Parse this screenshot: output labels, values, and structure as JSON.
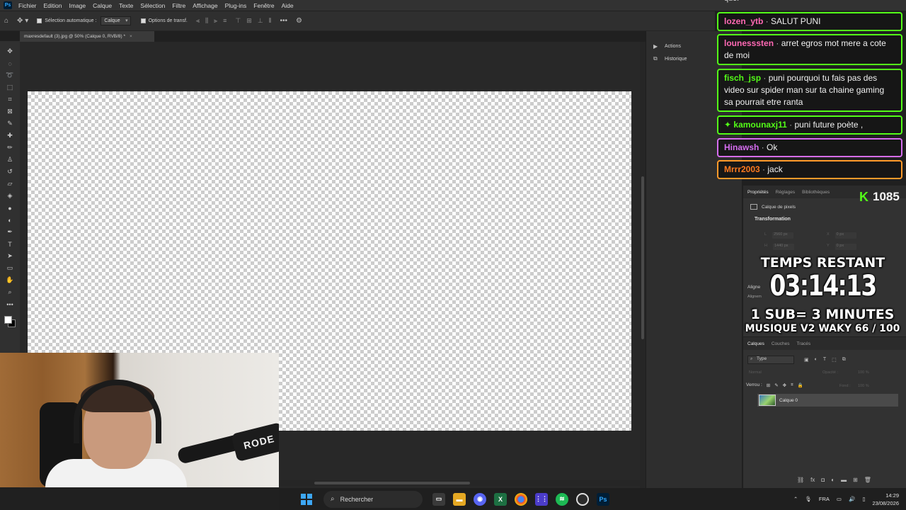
{
  "app": {
    "logo": "Ps",
    "menu": [
      "Fichier",
      "Edition",
      "Image",
      "Calque",
      "Texte",
      "Sélection",
      "Filtre",
      "Affichage",
      "Plug-ins",
      "Fenêtre",
      "Aide"
    ]
  },
  "options_bar": {
    "auto_select_label": "Sélection automatique :",
    "auto_select_target": "Calque",
    "transform_options_label": "Options de transf."
  },
  "document": {
    "tab_title": "maxresdefault (3).jpg @ 50% (Calque 0, RVB/8) *"
  },
  "panel_dock": {
    "items": [
      {
        "label": "Actions",
        "icon": "play-icon"
      },
      {
        "label": "Historique",
        "icon": "history-icon"
      }
    ]
  },
  "properties": {
    "tabs": [
      "Propriétés",
      "Réglages",
      "Bibliothèques"
    ],
    "layer_type": "Calque de pixels",
    "transform_heading": "Transformation",
    "fields": {
      "w_label": "L",
      "w_value": "2560 px",
      "x_label": "X",
      "x_value": "0 px",
      "h_label": "H",
      "h_value": "1440 px",
      "y_label": "Y",
      "y_value": "0 px"
    },
    "align_heading": "Aligne",
    "align_sub": "Alignem"
  },
  "layers_panel": {
    "tabs": [
      "Calques",
      "Couches",
      "Tracés"
    ],
    "filter_label": "Type",
    "blend_mode": "Normal",
    "opacity_label": "Opacité :",
    "opacity_value": "100 %",
    "lock_label": "Verrou :",
    "fill_label": "Fond :",
    "fill_value": "100 %",
    "layers": [
      {
        "name": "Calque 0"
      }
    ]
  },
  "chat": {
    "partial_top": "quoi",
    "messages": [
      {
        "user": "lozen_ytb",
        "text": "SALUT PUNI",
        "color": "#ff69b4"
      },
      {
        "user": "lounesssten",
        "text": "arret egros mot mere a cote de moi",
        "color": "#ff69b4"
      },
      {
        "user": "fisch_jsp",
        "text": "puni pourquoi tu fais pas des video sur spider man sur ta chaine gaming sa pourrait etre ranta",
        "color": "#53fc18"
      },
      {
        "user": "kamounaxj11",
        "text": "puni future poète ,",
        "color": "#53fc18"
      },
      {
        "user": "Hinawsh",
        "text": "Ok",
        "color": "#d66df0"
      },
      {
        "user": "Mrrr2003",
        "text": "jack",
        "color": "#ff7a1f"
      }
    ]
  },
  "overlay": {
    "kick_logo": "K",
    "viewer_count": "1085",
    "timer_title": "TEMPS RESTANT",
    "timer_value": "03:14:13",
    "sub_rule": "1 SUB= 3 MINUTES",
    "music_line": "MUSIQUE V2 WAKY 66 / 100"
  },
  "webcam": {
    "mic_brand": "RODE"
  },
  "taskbar": {
    "search_placeholder": "Rechercher",
    "language": "FRA",
    "time": "14:29",
    "date": "23/08/2026",
    "apps": [
      "file-explorer-icon",
      "folder-icon",
      "discord-icon",
      "excel-icon",
      "chrome-icon",
      "grid-app-icon",
      "spotify-icon",
      "obs-icon",
      "photoshop-icon"
    ]
  },
  "colors": {
    "accent": "#31a8ff",
    "kick_green": "#53fc18"
  }
}
